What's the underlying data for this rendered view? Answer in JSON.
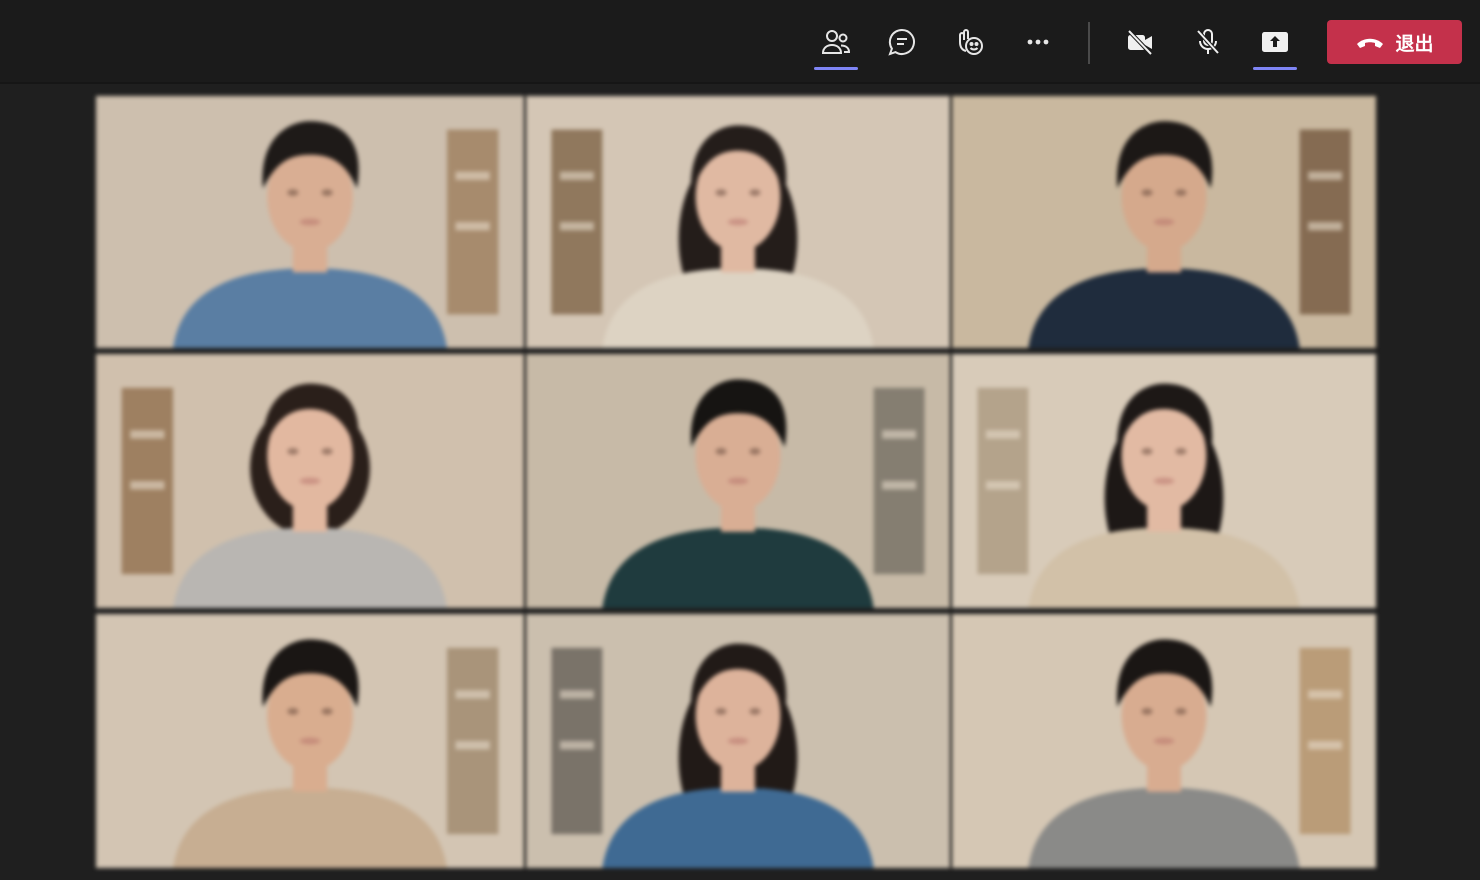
{
  "toolbar": {
    "buttons": [
      {
        "id": "people",
        "icon": "people-icon",
        "active": true
      },
      {
        "id": "chat",
        "icon": "chat-icon",
        "active": false
      },
      {
        "id": "react",
        "icon": "react-icon",
        "active": false
      },
      {
        "id": "more",
        "icon": "more-icon",
        "active": false
      },
      {
        "id": "camera",
        "icon": "camera-off-icon",
        "active": false
      },
      {
        "id": "mic",
        "icon": "mic-off-icon",
        "active": false
      },
      {
        "id": "share",
        "icon": "share-screen-icon",
        "active": true
      }
    ],
    "leave_label": "退出",
    "leave_color": "#c4314b",
    "accent_color": "#7f85f5"
  },
  "participants": [
    {
      "bg": "#cdbfae",
      "skin": "#d9ae93",
      "hair": "#1e1a18",
      "shirt": "#5a7ea3",
      "hair_style": "short",
      "furniture": "#9a7a57"
    },
    {
      "bg": "#d4c6b5",
      "skin": "#e0b9a2",
      "hair": "#241d1a",
      "shirt": "#ddd3c3",
      "hair_style": "long",
      "furniture": "#7a5d40"
    },
    {
      "bg": "#c9b89f",
      "skin": "#d5a98c",
      "hair": "#1c1816",
      "shirt": "#1f2c3d",
      "hair_style": "short",
      "furniture": "#6e5238"
    },
    {
      "bg": "#d0c0ad",
      "skin": "#e2b8a0",
      "hair": "#2a1f1a",
      "shirt": "#b9b6b2",
      "hair_style": "bob",
      "furniture": "#8d6b48"
    },
    {
      "bg": "#c7baa7",
      "skin": "#d9ae94",
      "hair": "#161412",
      "shirt": "#1f3b3e",
      "hair_style": "short",
      "furniture": "#6f6a5f"
    },
    {
      "bg": "#d8cbb9",
      "skin": "#e2baa3",
      "hair": "#1d1816",
      "shirt": "#d2c1a8",
      "hair_style": "long",
      "furniture": "#a8957c"
    },
    {
      "bg": "#d3c5b3",
      "skin": "#d9ad8f",
      "hair": "#1a1614",
      "shirt": "#c7ae92",
      "hair_style": "short",
      "furniture": "#9b8367"
    },
    {
      "bg": "#cbbfae",
      "skin": "#ddb39b",
      "hair": "#211a17",
      "shirt": "#3f6a93",
      "hair_style": "long",
      "furniture": "#5f5a52"
    },
    {
      "bg": "#d5c7b4",
      "skin": "#d8ac90",
      "hair": "#1a1614",
      "shirt": "#8a8a88",
      "hair_style": "short",
      "furniture": "#b08d64"
    }
  ]
}
